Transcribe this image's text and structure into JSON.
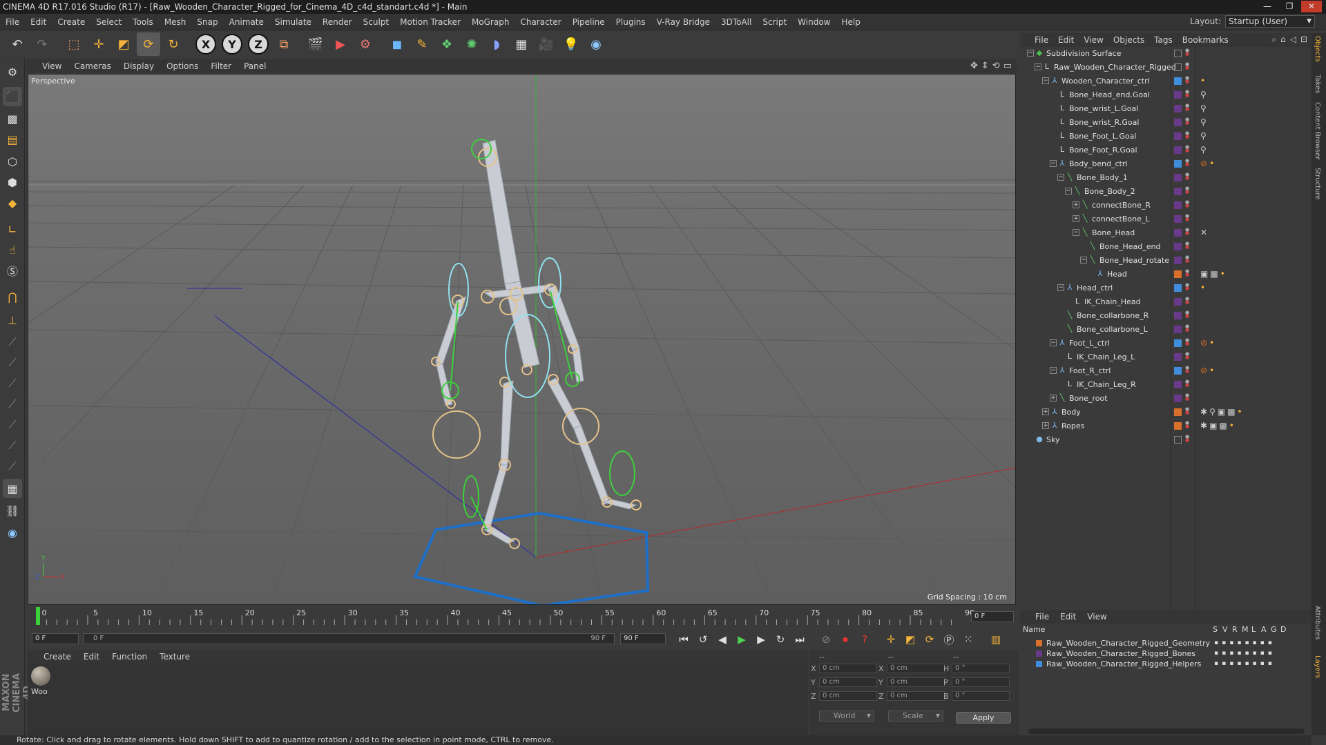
{
  "window": {
    "title": "CINEMA 4D R17.016 Studio (R17) - [Raw_Wooden_Character_Rigged_for_Cinema_4D_c4d_standart.c4d *] - Main"
  },
  "menubar": [
    "File",
    "Edit",
    "Create",
    "Select",
    "Tools",
    "Mesh",
    "Snap",
    "Animate",
    "Simulate",
    "Render",
    "Sculpt",
    "Motion Tracker",
    "MoGraph",
    "Character",
    "Pipeline",
    "Plugins",
    "V-Ray Bridge",
    "3DToAll",
    "Script",
    "Window",
    "Help"
  ],
  "layout": {
    "label": "Layout:",
    "value": "Startup (User)"
  },
  "toolbar": {
    "axis_x": "X",
    "axis_y": "Y",
    "axis_z": "Z"
  },
  "viewport": {
    "menu": [
      "View",
      "Cameras",
      "Display",
      "Options",
      "Filter",
      "Panel"
    ],
    "label": "Perspective",
    "grid_spacing": "Grid Spacing : 10 cm"
  },
  "timeline": {
    "ticks": [
      "0",
      "5",
      "10",
      "15",
      "20",
      "25",
      "30",
      "35",
      "40",
      "45",
      "50",
      "55",
      "60",
      "65",
      "70",
      "75",
      "80",
      "85",
      "90"
    ],
    "current_frame": "0 F",
    "start_frame": "0 F",
    "range_start": "0 F",
    "range_end": "90 F",
    "end_frame": "90 F"
  },
  "material_manager": {
    "menu": [
      "Create",
      "Edit",
      "Function",
      "Texture"
    ],
    "materials": [
      {
        "name": "Woo"
      }
    ]
  },
  "coordinates": {
    "header": [
      "--",
      "--",
      "--"
    ],
    "rows": [
      {
        "l1": "X",
        "v1": "0 cm",
        "l2": "X",
        "v2": "0 cm",
        "l3": "H",
        "v3": "0 °"
      },
      {
        "l1": "Y",
        "v1": "0 cm",
        "l2": "Y",
        "v2": "0 cm",
        "l3": "P",
        "v3": "0 °"
      },
      {
        "l1": "Z",
        "v1": "0 cm",
        "l2": "Z",
        "v2": "0 cm",
        "l3": "B",
        "v3": "0 °"
      }
    ],
    "mode": "World",
    "size_mode": "Scale",
    "apply": "Apply"
  },
  "status": "Rotate: Click and drag to rotate elements. Hold down SHIFT to add to quantize rotation / add to the selection in point mode, CTRL to remove.",
  "object_manager": {
    "menu": [
      "File",
      "Edit",
      "View",
      "Objects",
      "Tags",
      "Bookmarks"
    ],
    "objects": [
      {
        "name": "Subdivision Surface",
        "depth": 0,
        "expander": "−",
        "icon": "subdivision-icon",
        "icon_glyph": "◆",
        "icon_color": "#4fbf4f",
        "layer": "",
        "tags": []
      },
      {
        "name": "Raw_Wooden_Character_Rigged",
        "depth": 1,
        "expander": "−",
        "icon": "null-icon",
        "icon_glyph": "L",
        "icon_color": "#dcdcdc",
        "layer": "",
        "tags": []
      },
      {
        "name": "Wooden_Character_ctrl",
        "depth": 2,
        "expander": "−",
        "icon": "joint-icon",
        "icon_glyph": "⅄",
        "icon_color": "#7fbfff",
        "layer": "#3f8ddb",
        "tags": [
          "•"
        ]
      },
      {
        "name": "Bone_Head_end.Goal",
        "depth": 3,
        "expander": "",
        "icon": "null-icon",
        "icon_glyph": "L",
        "icon_color": "#dcdcdc",
        "layer": "#6a3a8a",
        "tags": [
          "⚲"
        ]
      },
      {
        "name": "Bone_wrist_L.Goal",
        "depth": 3,
        "expander": "",
        "icon": "null-icon",
        "icon_glyph": "L",
        "icon_color": "#dcdcdc",
        "layer": "#6a3a8a",
        "tags": [
          "⚲"
        ]
      },
      {
        "name": "Bone_wrist_R.Goal",
        "depth": 3,
        "expander": "",
        "icon": "null-icon",
        "icon_glyph": "L",
        "icon_color": "#dcdcdc",
        "layer": "#6a3a8a",
        "tags": [
          "⚲"
        ]
      },
      {
        "name": "Bone_Foot_L.Goal",
        "depth": 3,
        "expander": "",
        "icon": "null-icon",
        "icon_glyph": "L",
        "icon_color": "#dcdcdc",
        "layer": "#6a3a8a",
        "tags": [
          "⚲"
        ]
      },
      {
        "name": "Bone_Foot_R.Goal",
        "depth": 3,
        "expander": "",
        "icon": "null-icon",
        "icon_glyph": "L",
        "icon_color": "#dcdcdc",
        "layer": "#6a3a8a",
        "tags": [
          "⚲"
        ]
      },
      {
        "name": "Body_bend_ctrl",
        "depth": 3,
        "expander": "−",
        "icon": "joint-icon",
        "icon_glyph": "⅄",
        "icon_color": "#7fbfff",
        "layer": "#3f8ddb",
        "tags": [
          "⊘",
          "•"
        ]
      },
      {
        "name": "Bone_Body_1",
        "depth": 4,
        "expander": "−",
        "icon": "bone-icon",
        "icon_glyph": "╲",
        "icon_color": "#5fd06f",
        "layer": "#6a3a8a",
        "tags": []
      },
      {
        "name": "Bone_Body_2",
        "depth": 5,
        "expander": "−",
        "icon": "bone-icon",
        "icon_glyph": "╲",
        "icon_color": "#5fd06f",
        "layer": "#6a3a8a",
        "tags": []
      },
      {
        "name": "connectBone_R",
        "depth": 6,
        "expander": "+",
        "icon": "bone-icon",
        "icon_glyph": "╲",
        "icon_color": "#5fd06f",
        "layer": "#6a3a8a",
        "tags": []
      },
      {
        "name": "connectBone_L",
        "depth": 6,
        "expander": "+",
        "icon": "bone-icon",
        "icon_glyph": "╲",
        "icon_color": "#5fd06f",
        "layer": "#6a3a8a",
        "tags": []
      },
      {
        "name": "Bone_Head",
        "depth": 6,
        "expander": "−",
        "icon": "bone-icon",
        "icon_glyph": "╲",
        "icon_color": "#5fd06f",
        "layer": "#6a3a8a",
        "tags": [
          "✕"
        ]
      },
      {
        "name": "Bone_Head_end",
        "depth": 7,
        "expander": "",
        "icon": "bone-icon",
        "icon_glyph": "╲",
        "icon_color": "#5fd06f",
        "layer": "#6a3a8a",
        "tags": []
      },
      {
        "name": "Bone_Head_rotate",
        "depth": 7,
        "expander": "−",
        "icon": "bone-icon",
        "icon_glyph": "╲",
        "icon_color": "#5fd06f",
        "layer": "#6a3a8a",
        "tags": []
      },
      {
        "name": "Head",
        "depth": 8,
        "expander": "",
        "icon": "joint-icon",
        "icon_glyph": "⅄",
        "icon_color": "#7fbfff",
        "layer": "#d86f2a",
        "tags": [
          "▣",
          "▩",
          "•"
        ]
      },
      {
        "name": "Head_ctrl",
        "depth": 4,
        "expander": "−",
        "icon": "joint-icon",
        "icon_glyph": "⅄",
        "icon_color": "#7fbfff",
        "layer": "#3f8ddb",
        "tags": [
          "•"
        ]
      },
      {
        "name": "IK_Chain_Head",
        "depth": 5,
        "expander": "",
        "icon": "null-icon",
        "icon_glyph": "L",
        "icon_color": "#dcdcdc",
        "layer": "#6a3a8a",
        "tags": []
      },
      {
        "name": "Bone_collarbone_R",
        "depth": 4,
        "expander": "",
        "icon": "bone-icon",
        "icon_glyph": "╲",
        "icon_color": "#5fd06f",
        "layer": "#6a3a8a",
        "tags": []
      },
      {
        "name": "Bone_collarbone_L",
        "depth": 4,
        "expander": "",
        "icon": "bone-icon",
        "icon_glyph": "╲",
        "icon_color": "#5fd06f",
        "layer": "#6a3a8a",
        "tags": []
      },
      {
        "name": "Foot_L_ctrl",
        "depth": 3,
        "expander": "−",
        "icon": "joint-icon",
        "icon_glyph": "⅄",
        "icon_color": "#7fbfff",
        "layer": "#3f8ddb",
        "tags": [
          "⊘",
          "•"
        ]
      },
      {
        "name": "IK_Chain_Leg_L",
        "depth": 4,
        "expander": "",
        "icon": "null-icon",
        "icon_glyph": "L",
        "icon_color": "#dcdcdc",
        "layer": "#6a3a8a",
        "tags": []
      },
      {
        "name": "Foot_R_ctrl",
        "depth": 3,
        "expander": "−",
        "icon": "joint-icon",
        "icon_glyph": "⅄",
        "icon_color": "#7fbfff",
        "layer": "#3f8ddb",
        "tags": [
          "⊘",
          "•"
        ]
      },
      {
        "name": "IK_Chain_Leg_R",
        "depth": 4,
        "expander": "",
        "icon": "null-icon",
        "icon_glyph": "L",
        "icon_color": "#dcdcdc",
        "layer": "#6a3a8a",
        "tags": []
      },
      {
        "name": "Bone_root",
        "depth": 3,
        "expander": "+",
        "icon": "bone-icon",
        "icon_glyph": "╲",
        "icon_color": "#5fd06f",
        "layer": "#6a3a8a",
        "tags": []
      },
      {
        "name": "Body",
        "depth": 2,
        "expander": "+",
        "icon": "joint-icon",
        "icon_glyph": "⅄",
        "icon_color": "#7fbfff",
        "layer": "#d86f2a",
        "tags": [
          "✱",
          "⚲",
          "▣",
          "▩",
          "•"
        ]
      },
      {
        "name": "Ropes",
        "depth": 2,
        "expander": "+",
        "icon": "joint-icon",
        "icon_glyph": "⅄",
        "icon_color": "#7fbfff",
        "layer": "#d86f2a",
        "tags": [
          "✱",
          "▣",
          "▩",
          "•"
        ]
      },
      {
        "name": "Sky",
        "depth": 0,
        "expander": "",
        "icon": "sky-icon",
        "icon_glyph": "●",
        "icon_color": "#7fb8e8",
        "layer": "",
        "tags": []
      }
    ]
  },
  "side_tabs": [
    "Objects",
    "Takes",
    "Content Browser",
    "Structure"
  ],
  "side_tabs_lower": [
    "Attributes",
    "Layers"
  ],
  "layer_manager": {
    "menu": [
      "File",
      "Edit",
      "View"
    ],
    "columns": [
      "Name",
      "S",
      "V",
      "R",
      "M",
      "L",
      "A",
      "G",
      "D"
    ],
    "layers": [
      {
        "name": "Raw_Wooden_Character_Rigged_Geometry",
        "color": "#d86f2a"
      },
      {
        "name": "Raw_Wooden_Character_Rigged_Bones",
        "color": "#6a3a8a"
      },
      {
        "name": "Raw_Wooden_Character_Rigged_Helpers",
        "color": "#3f8ddb"
      }
    ]
  }
}
